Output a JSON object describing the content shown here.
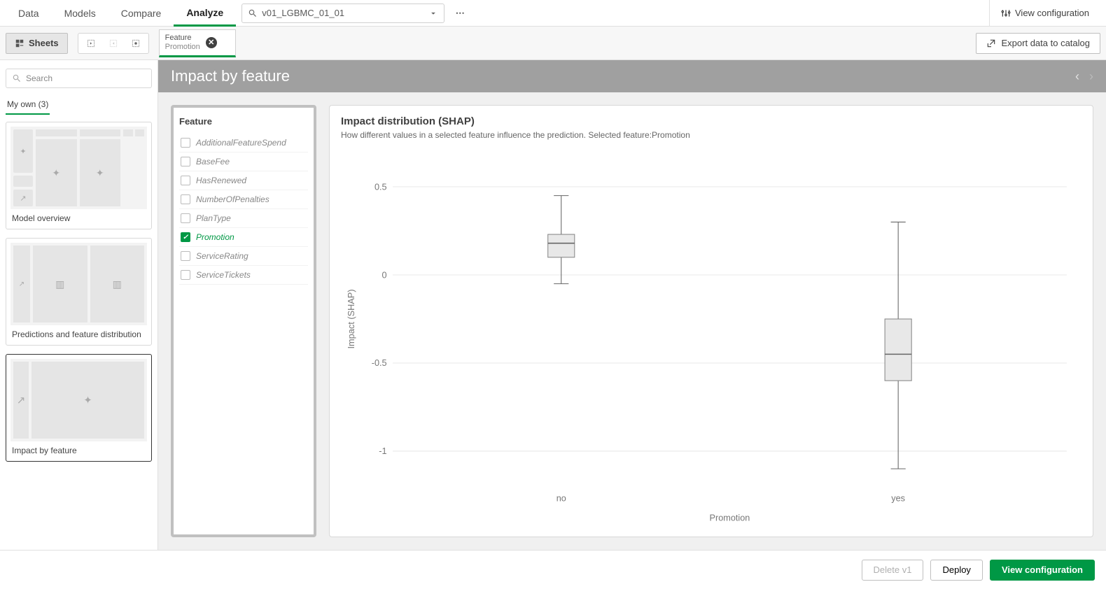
{
  "nav": {
    "tabs": [
      "Data",
      "Models",
      "Compare",
      "Analyze"
    ],
    "active_index": 3,
    "dropdown_value": "v01_LGBMC_01_01",
    "view_config_label": "View configuration"
  },
  "toolbar": {
    "sheets_label": "Sheets",
    "feature_tab_title": "Feature",
    "feature_tab_value": "Promotion",
    "export_label": "Export data to catalog"
  },
  "sidebar": {
    "search_placeholder": "Search",
    "my_own_label": "My own (3)",
    "cards": [
      {
        "caption": "Model overview",
        "selected": false
      },
      {
        "caption": "Predictions and feature distribution",
        "selected": false
      },
      {
        "caption": "Impact by feature",
        "selected": true
      }
    ]
  },
  "main": {
    "title": "Impact by feature",
    "feature_panel_title": "Feature",
    "features": [
      {
        "name": "AdditionalFeatureSpend",
        "selected": false
      },
      {
        "name": "BaseFee",
        "selected": false
      },
      {
        "name": "HasRenewed",
        "selected": false
      },
      {
        "name": "NumberOfPenalties",
        "selected": false
      },
      {
        "name": "PlanType",
        "selected": false
      },
      {
        "name": "Promotion",
        "selected": true
      },
      {
        "name": "ServiceRating",
        "selected": false
      },
      {
        "name": "ServiceTickets",
        "selected": false
      }
    ],
    "chart_title": "Impact distribution (SHAP)",
    "chart_sub": "How different values in a selected feature influence the prediction. Selected feature:Promotion"
  },
  "footer": {
    "delete_label": "Delete v1",
    "deploy_label": "Deploy",
    "view_config_label": "View configuration"
  },
  "chart_data": {
    "type": "boxplot",
    "title": "Impact distribution (SHAP)",
    "xlabel": "Promotion",
    "ylabel": "Impact (SHAP)",
    "ylim": [
      -1.2,
      0.7
    ],
    "yticks": [
      -1,
      -0.5,
      0,
      0.5
    ],
    "categories": [
      "no",
      "yes"
    ],
    "series": [
      {
        "category": "no",
        "whisker_low": -0.05,
        "q1": 0.1,
        "median": 0.18,
        "q3": 0.23,
        "whisker_high": 0.45
      },
      {
        "category": "yes",
        "whisker_low": -1.1,
        "q1": -0.6,
        "median": -0.45,
        "q3": -0.25,
        "whisker_high": 0.3
      }
    ]
  }
}
